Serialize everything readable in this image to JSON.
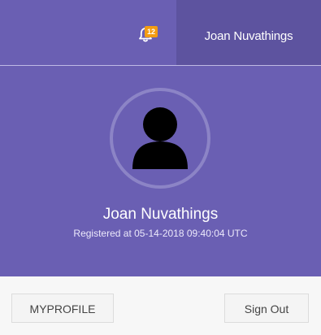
{
  "navbar": {
    "notifications": {
      "icon": "bell-icon",
      "count": "12",
      "badge_color": "#f39c12"
    },
    "user_menu_label": "Joan Nuvathings"
  },
  "user_panel": {
    "avatar_icon": "user-silhouette-icon",
    "name": "Joan Nuvathings",
    "registered": "Registered at 05-14-2018 09:40:04 UTC"
  },
  "footer": {
    "profile_button": "MYPROFILE",
    "signout_button": "Sign Out"
  },
  "colors": {
    "header_bg": "#6a5fb3",
    "active_toggle_bg": "#5d539f",
    "footer_bg": "#f7f7f7"
  }
}
